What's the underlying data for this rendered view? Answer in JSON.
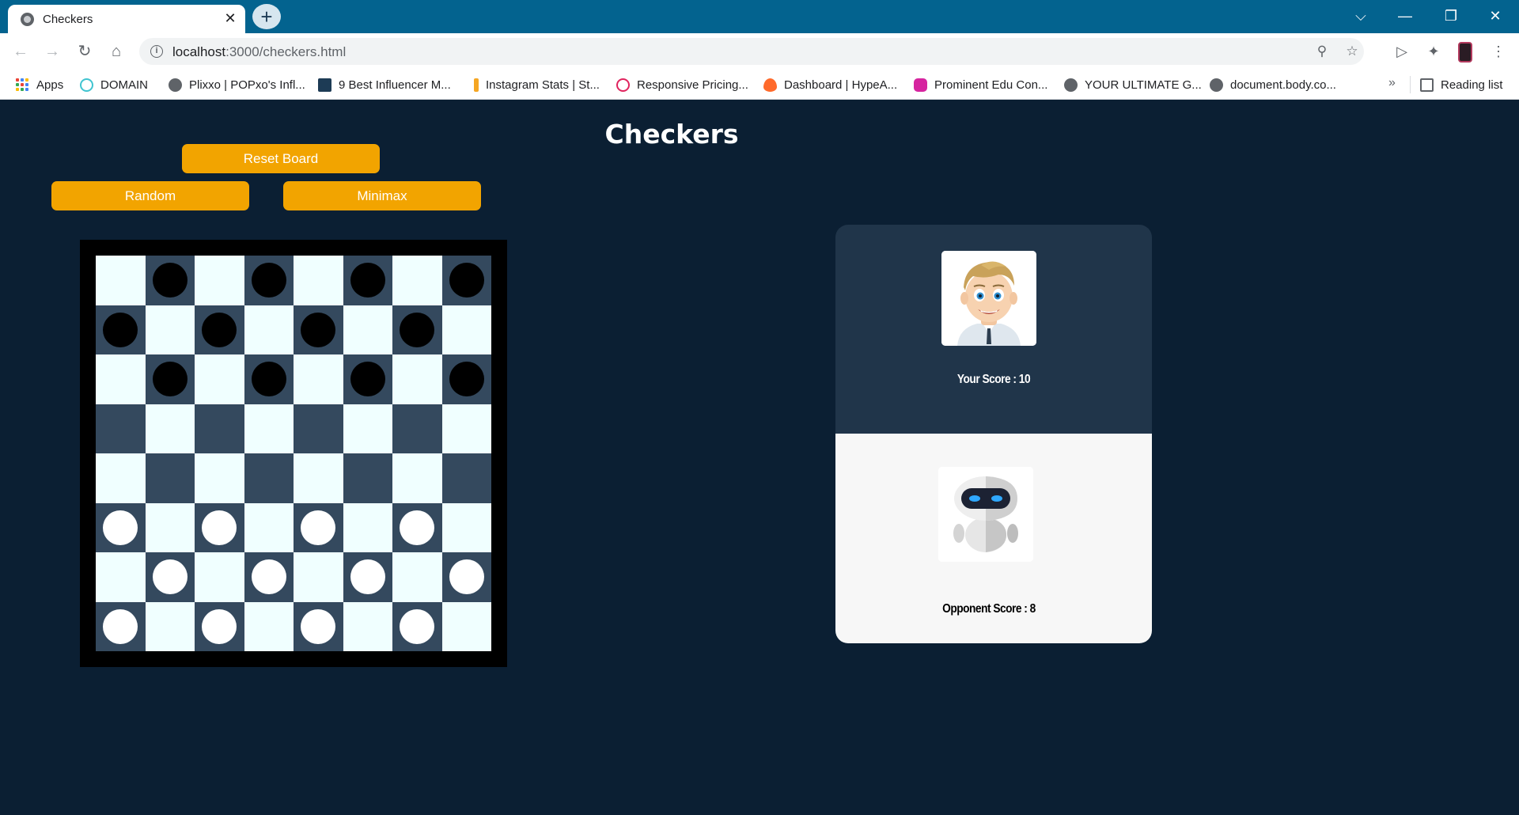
{
  "browser": {
    "tab_title": "Checkers",
    "tab_close": "✕",
    "new_tab": "+",
    "url_host": "localhost",
    "url_path": ":3000/checkers.html",
    "window_controls": {
      "tabsearch": "⌵",
      "minimize": "—",
      "restore": "❐",
      "close": "✕"
    }
  },
  "bookmarks": {
    "items": [
      {
        "label": "Apps",
        "icon": "apps-grid-icon"
      },
      {
        "label": "DOMAIN",
        "icon": "domain-icon",
        "color": "#40c4d0"
      },
      {
        "label": "Plixxo | POPxo's Infl...",
        "icon": "globe-icon",
        "color": "#5f6368"
      },
      {
        "label": "9 Best Influencer M...",
        "icon": "chart-favicon-icon",
        "color": "#1d3b55"
      },
      {
        "label": "Instagram Stats | St...",
        "icon": "bolt-icon",
        "color": "#f5a623"
      },
      {
        "label": "Responsive Pricing...",
        "icon": "target-icon",
        "color": "#e0245e"
      },
      {
        "label": "Dashboard | HypeA...",
        "icon": "flame-icon",
        "color": "#ff6a2b"
      },
      {
        "label": "Prominent Edu Con...",
        "icon": "instagram-icon",
        "color": "#d6249f"
      },
      {
        "label": "YOUR ULTIMATE G...",
        "icon": "globe-icon",
        "color": "#5f6368"
      },
      {
        "label": "document.body.co...",
        "icon": "globe-icon",
        "color": "#5f6368"
      }
    ],
    "overflow": "»",
    "reading_list": "Reading list"
  },
  "game": {
    "title": "Checkers",
    "reset_label": "Reset Board",
    "random_label": "Random",
    "minimax_label": "Minimax",
    "your_score": "Your Score : 10",
    "opponent_score": "Opponent Score : 8",
    "board": [
      ".b.b.b.b",
      "b.b.b.b.",
      ".b.b.b.b",
      "........",
      "........",
      "w.w.w.w.",
      ".w.w.w.w",
      "w.w.w.w."
    ]
  },
  "colors": {
    "page_bg": "#0b1f33",
    "accent": "#f2a400",
    "dark_square": "#34495e",
    "light_square": "#f0ffff",
    "panel_dark": "#20354a",
    "panel_light": "#f7f7f7"
  }
}
